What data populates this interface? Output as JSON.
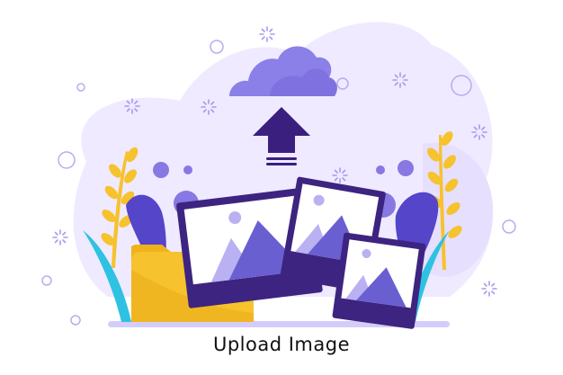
{
  "caption": "Upload Image",
  "icons": [
    "cloud-icon",
    "upload-arrow-icon",
    "folder-icon",
    "photo-icon"
  ],
  "colors": {
    "blob": "#efeaff",
    "blob_dark": "#d9d0fb",
    "cloud": "#8b7fe8",
    "arrow": "#3b1f7e",
    "folder": "#f6c22e",
    "folder_back": "#f0b21a",
    "photo_frame": "#3d2480",
    "photo_bg": "#ffffff",
    "photo_mountain": "#6a5fd0",
    "photo_mountain_light": "#b9b1f2",
    "leaf_teal": "#2fc1e2",
    "leaf_purple": "#5445c9",
    "leaf_yellow": "#f6c22e",
    "dots": "#8878e3"
  }
}
